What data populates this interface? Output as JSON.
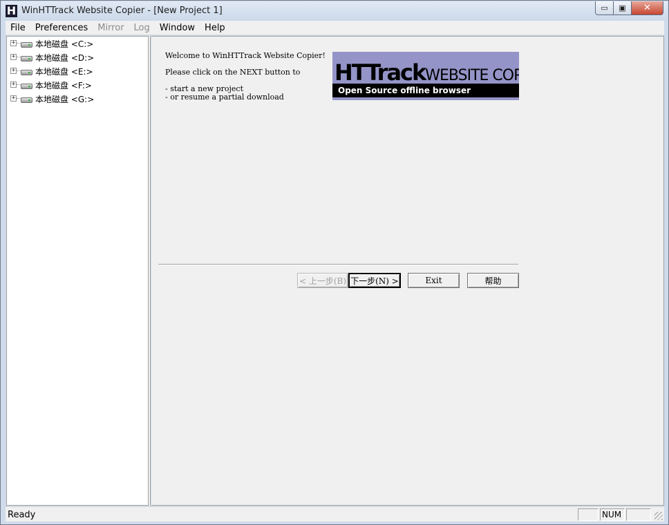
{
  "window": {
    "app_icon_glyph": "H",
    "title": "WinHTTrack Website Copier - [New Project 1]",
    "minimize_glyph": "▭",
    "maximize_glyph": "▣",
    "close_glyph": "✕"
  },
  "menu": {
    "items": [
      {
        "label": "File",
        "enabled": true
      },
      {
        "label": "Preferences",
        "enabled": true
      },
      {
        "label": "Mirror",
        "enabled": false
      },
      {
        "label": "Log",
        "enabled": false
      },
      {
        "label": "Window",
        "enabled": true
      },
      {
        "label": "Help",
        "enabled": true
      }
    ]
  },
  "tree": {
    "expander_glyph": "+",
    "items": [
      {
        "label": "本地磁盘 <C:>",
        "icon": "drive-icon"
      },
      {
        "label": "本地磁盘 <D:>",
        "icon": "drive-icon"
      },
      {
        "label": "本地磁盘 <E:>",
        "icon": "drive-icon"
      },
      {
        "label": "本地磁盘 <F:>",
        "icon": "drive-icon"
      },
      {
        "label": "本地磁盘 <G:>",
        "icon": "drive-icon"
      }
    ]
  },
  "wizard": {
    "line1": "Welcome to WinHTTrack Website Copier!",
    "line2": "Please click on the NEXT button to",
    "line3": "- start a new project",
    "line4": "- or resume a partial download",
    "banner_title": "HTTrack",
    "banner_subtitle": "WEBSITE COPIER",
    "banner_tagline": "Open Source offline browser",
    "back_label": "< 上一步(B)",
    "next_label": "下一步(N) >",
    "exit_label": "Exit",
    "help_label": "帮助"
  },
  "status": {
    "text": "Ready",
    "pane1": "",
    "pane2": "NUM",
    "pane3": ""
  },
  "colors": {
    "banner_bg": "#9494c8",
    "window_frame": "#cfdbea",
    "close_button": "#c6462f"
  }
}
